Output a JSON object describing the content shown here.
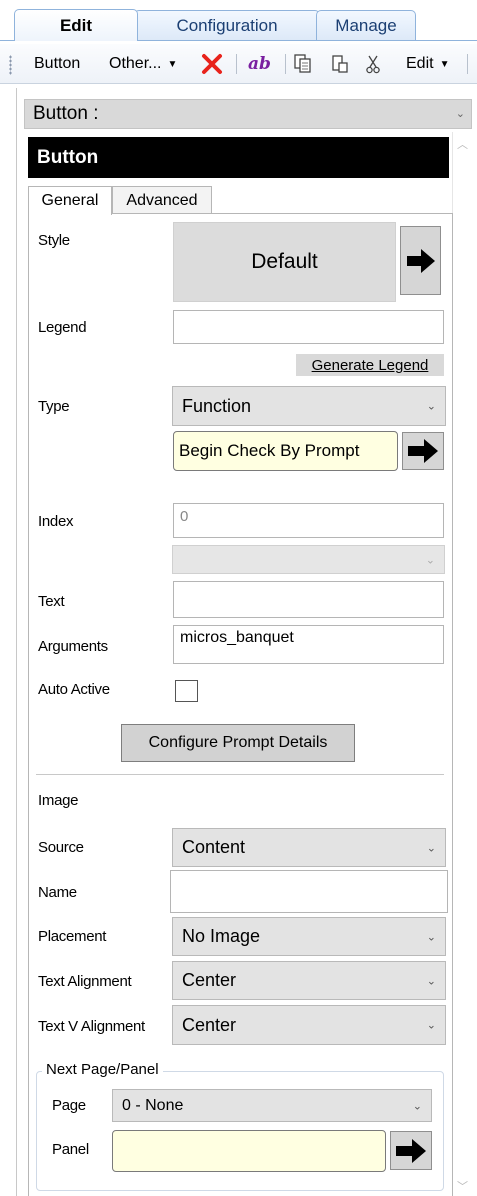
{
  "tabs": [
    {
      "label": "Edit",
      "active": true
    },
    {
      "label": "Configuration",
      "active": false
    },
    {
      "label": "Manage",
      "active": false
    }
  ],
  "toolbar": {
    "button_label": "Button",
    "other_label": "Other...",
    "bold_label": "ab",
    "edit_label": "Edit"
  },
  "selector": {
    "value": "Button :"
  },
  "title": "Button",
  "subtabs": [
    {
      "label": "General",
      "active": true
    },
    {
      "label": "Advanced",
      "active": false
    }
  ],
  "general": {
    "style_label": "Style",
    "style_value": "Default",
    "legend_label": "Legend",
    "legend_value": "",
    "generate_legend": "Generate Legend",
    "type_label": "Type",
    "type_value": "Function",
    "function_value": "Begin Check By Prompt",
    "index_label": "Index",
    "index_value": "0",
    "index_sub_value": "",
    "text_label": "Text",
    "text_value": "",
    "arguments_label": "Arguments",
    "arguments_value": "micros_banquet",
    "auto_active_label": "Auto Active",
    "auto_active_checked": false,
    "configure_prompt": "Configure Prompt Details"
  },
  "image": {
    "section_label": "Image",
    "source_label": "Source",
    "source_value": "Content",
    "name_label": "Name",
    "name_value": "",
    "placement_label": "Placement",
    "placement_value": "No Image",
    "text_align_label": "Text Alignment",
    "text_align_value": "Center",
    "text_valign_label": "Text V Alignment",
    "text_valign_value": "Center"
  },
  "next_page": {
    "group_label": "Next Page/Panel",
    "page_label": "Page",
    "page_value": "0 - None",
    "panel_label": "Panel",
    "panel_value": ""
  },
  "colors": {
    "accent_blue": "#8fb3dc",
    "delete_red": "#e8231c",
    "bold_purple": "#7a1fa0",
    "highlight_yellow": "#ffffe1"
  }
}
